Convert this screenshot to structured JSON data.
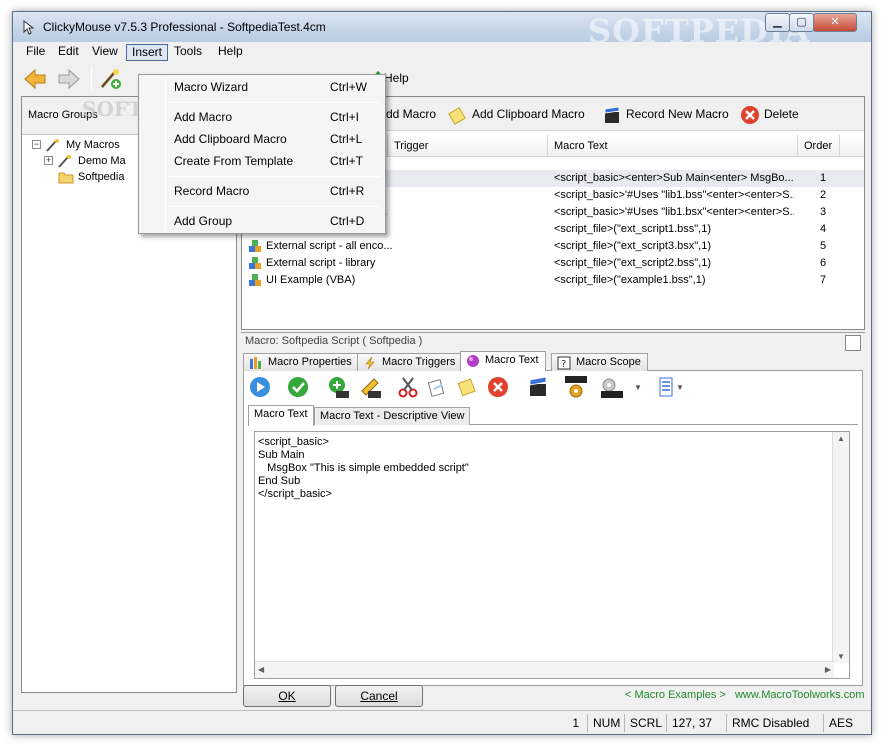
{
  "window": {
    "title": "ClickyMouse v7.5.3 Professional - SoftpediaTest.4cm",
    "watermark": "SOFTPEDIA"
  },
  "menubar": {
    "items": [
      "File",
      "Edit",
      "View",
      "Insert",
      "Tools",
      "Help"
    ],
    "active": "Insert"
  },
  "insert_menu": {
    "items": [
      {
        "label": "Macro Wizard",
        "shortcut": "Ctrl+W"
      },
      {
        "label": "Add Macro",
        "shortcut": "Ctrl+I"
      },
      {
        "label": "Add Clipboard Macro",
        "shortcut": "Ctrl+L"
      },
      {
        "label": "Create From Template",
        "shortcut": "Ctrl+T"
      },
      {
        "label": "Record Macro",
        "shortcut": "Ctrl+R"
      },
      {
        "label": "Add Group",
        "shortcut": "Ctrl+D"
      }
    ]
  },
  "toolbar": {
    "help_label": "Help"
  },
  "left_panel": {
    "header": "Macro Groups",
    "watermark": "SOFTPEDIA",
    "tree": [
      {
        "label": "My Macros",
        "expander": "−"
      },
      {
        "label": "Demo Ma",
        "expander": "+"
      },
      {
        "label": "Softpedia",
        "expander": ""
      }
    ]
  },
  "macro_toolbar": {
    "add_macro": "Add Macro",
    "add_clipboard_macro": "Add Clipboard Macro",
    "record_new_macro": "Record New Macro",
    "delete": "Delete"
  },
  "macro_list": {
    "columns": [
      "Trigger",
      "Macro Text",
      "Order"
    ],
    "rows": [
      {
        "name": "",
        "trigger": "",
        "text": "<script_basic><enter>Sub Main<enter>   MsgBo...",
        "order": "1"
      },
      {
        "name": "ary",
        "trigger": "",
        "text": "<script_basic>'#Uses \"lib1.bss\"<enter><enter>S...",
        "order": "2"
      },
      {
        "name": "ar...",
        "trigger": "",
        "text": "<script_basic>'#Uses \"lib1.bsx\"<enter><enter>S...",
        "order": "3"
      },
      {
        "name": "",
        "trigger": "",
        "text": "<script_file>(\"ext_script1.bss\",1)",
        "order": "4"
      },
      {
        "name": "External script - all enco...",
        "trigger": "",
        "text": "<script_file>(\"ext_script3.bsx\",1)",
        "order": "5"
      },
      {
        "name": "External script - library",
        "trigger": "",
        "text": "<script_file>(\"ext_script2.bss\",1)",
        "order": "6"
      },
      {
        "name": "UI Example (VBA)",
        "trigger": "",
        "text": "<script_file>(\"example1.bss\",1)",
        "order": "7"
      }
    ]
  },
  "macro_detail": {
    "caption": "Macro: Softpedia Script ( Softpedia )",
    "tabs": [
      "Macro Properties",
      "Macro Triggers",
      "Macro Text",
      "Macro Scope"
    ],
    "active_tab": "Macro Text",
    "subtabs": [
      "Macro Text",
      "Macro Text - Descriptive View"
    ],
    "editor_text": "<script_basic>\nSub Main\n   MsgBox \"This is simple embedded script\"\nEnd Sub\n</script_basic>"
  },
  "buttons": {
    "ok": "OK",
    "cancel": "Cancel"
  },
  "footer": {
    "examples_link": "< Macro Examples >",
    "site_link": "www.MacroToolworks.com"
  },
  "statusbar": {
    "page": "1",
    "num": "NUM",
    "scrl": "SCRL",
    "pos": "127, 37",
    "rmc": "RMC Disabled",
    "aes": "AES"
  },
  "colors": {
    "accent_green": "#1d8a2a",
    "menu_highlight": "#dce6f4",
    "delete_red": "#e0412c"
  }
}
